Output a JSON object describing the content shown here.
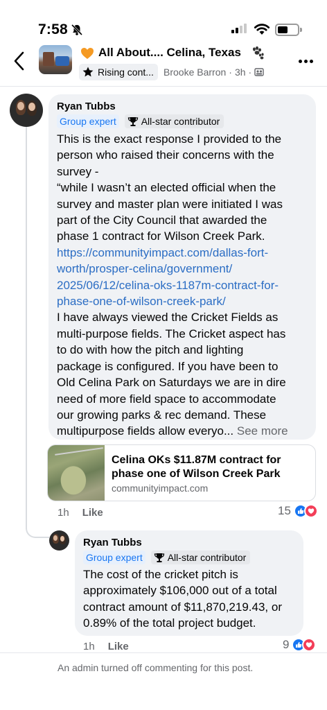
{
  "status_bar": {
    "time": "7:58"
  },
  "header": {
    "group_name": "All About.... Celina, Texas",
    "rising_badge": "Rising cont...",
    "poster": "Brooke Barron",
    "age": "3h",
    "separator": "·"
  },
  "comment1": {
    "author": "Ryan Tubbs",
    "badge_expert": "Group expert",
    "badge_star": "All-star contributor",
    "lines": [
      {
        "text": "This is the exact response I provided to the",
        "link": false
      },
      {
        "text": "person who raised their concerns with the",
        "link": false
      },
      {
        "text": "survey -",
        "link": false
      },
      {
        "text": "“while I wasn’t an elected official when the",
        "link": false
      },
      {
        "text": "survey and master plan were initiated I was",
        "link": false
      },
      {
        "text": "part of the City Council that awarded the",
        "link": false
      },
      {
        "text": "phase 1 contract for Wilson Creek Park.",
        "link": false
      },
      {
        "text": "https://communityimpact.com/dallas-fort-",
        "link": true
      },
      {
        "text": "worth/prosper-celina/government/",
        "link": true
      },
      {
        "text": "2025/06/12/celina-oks-1187m-contract-for-",
        "link": true
      },
      {
        "text": "phase-one-of-wilson-creek-park/",
        "link": true
      },
      {
        "text": "I have always viewed the Cricket Fields as",
        "link": false
      },
      {
        "text": "multi-purpose fields. The Cricket aspect has",
        "link": false
      },
      {
        "text": "to do with how the pitch and lighting",
        "link": false
      },
      {
        "text": "package is configured. If you have been to",
        "link": false
      },
      {
        "text": "Old Celina Park on Saturdays we are in dire",
        "link": false
      },
      {
        "text": "need of more field space to accommodate",
        "link": false
      },
      {
        "text": "our growing parks & rec demand. These",
        "link": false
      }
    ],
    "last_line": "multipurpose fields allow everyo...",
    "see_more": "See more",
    "time": "1h",
    "like_label": "Like",
    "reaction_count": "15"
  },
  "link_card": {
    "title_line1": "Celina OKs $11.87M contract for",
    "title_line2": "phase one of Wilson Creek Park",
    "domain": "communityimpact.com"
  },
  "comment2": {
    "author": "Ryan Tubbs",
    "badge_expert": "Group expert",
    "badge_star": "All-star contributor",
    "lines": [
      "The cost of the cricket pitch is",
      "approximately $106,000 out of a total",
      "contract amount of $11,870,219.43, or",
      "0.89% of the total project budget."
    ],
    "time": "1h",
    "like_label": "Like",
    "reaction_count": "9"
  },
  "footer": {
    "note": "An admin turned off commenting for this post."
  },
  "colors": {
    "link": "#2b6dc4",
    "expert_badge": "#1876f2",
    "bubble": "#f0f2f5",
    "like_reaction": "#1876f2",
    "love_reaction": "#f33e58",
    "heart_emoji": "#f59a23"
  },
  "icons": [
    "bell-slash-icon",
    "signal-icon",
    "wifi-icon",
    "battery-icon",
    "back-chevron-icon",
    "orange-heart-icon",
    "paw-prints-icon",
    "star-icon",
    "group-privacy-icon",
    "more-dots-icon",
    "trophy-icon",
    "like-reaction-icon",
    "love-reaction-icon"
  ]
}
